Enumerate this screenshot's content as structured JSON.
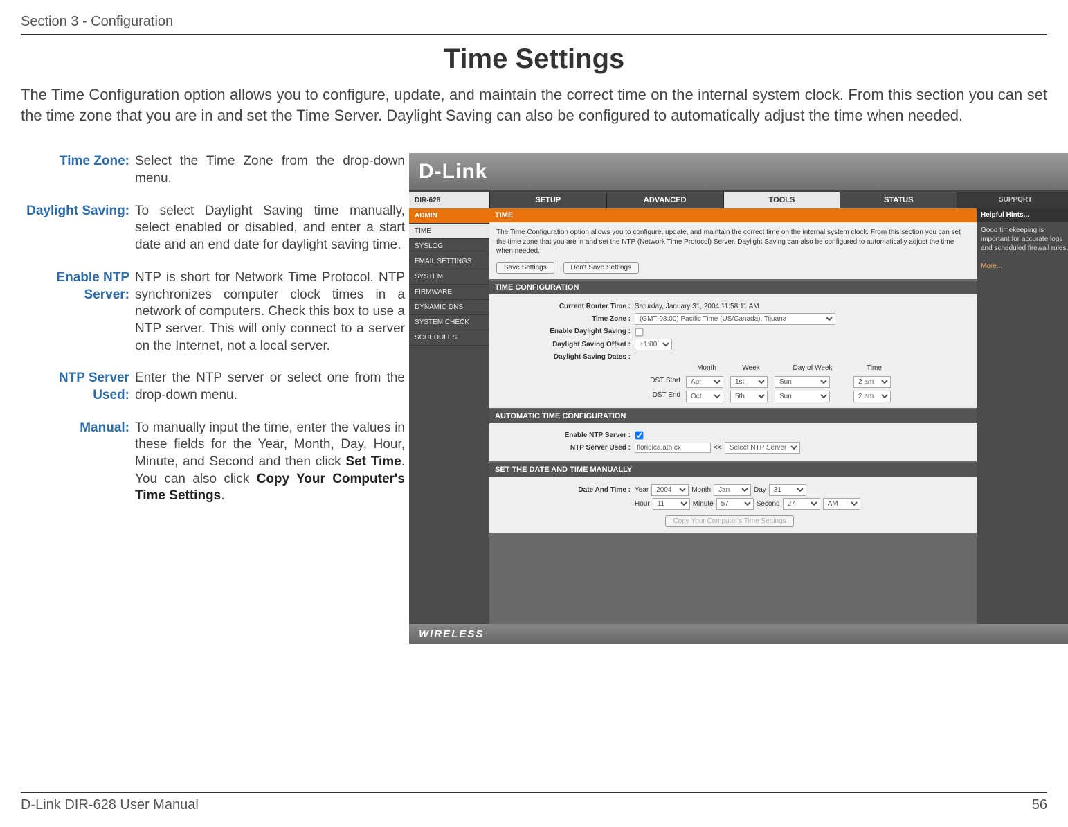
{
  "header": {
    "section": "Section 3 - Configuration"
  },
  "title": "Time Settings",
  "intro": "The Time Configuration option allows you to configure, update, and maintain the correct time on the internal system clock. From this section you can set the time zone that you are in and set the Time Server. Daylight Saving can also be configured to automatically adjust the time when needed.",
  "defs": [
    {
      "term": "Time Zone:",
      "desc": "Select the Time Zone from the drop-down menu."
    },
    {
      "term": "Daylight Saving:",
      "desc": "To select Daylight Saving time manually, select enabled or disabled, and enter a start date and an end date for daylight saving time."
    },
    {
      "term": "Enable NTP Server:",
      "desc": "NTP is short for Network Time Protocol. NTP synchronizes computer clock times in a network of computers. Check this box to use a NTP server. This will only connect to a server on the Internet, not a local server."
    },
    {
      "term": "NTP Server Used:",
      "desc": "Enter the NTP server or select one from the drop-down menu."
    },
    {
      "term": "Manual:",
      "desc_html": "To manually input the time, enter the values in these fields for the Year, Month, Day, Hour, Minute, and Second and then click <b>Set Time</b>. You can also click <b>Copy Your Computer's Time Settings</b>."
    }
  ],
  "router": {
    "logo": "D-Link",
    "model": "DIR-628",
    "tabs": [
      "SETUP",
      "ADVANCED",
      "TOOLS",
      "STATUS",
      "SUPPORT"
    ],
    "active_tab": "TOOLS",
    "side": [
      "ADMIN",
      "TIME",
      "SYSLOG",
      "EMAIL SETTINGS",
      "SYSTEM",
      "FIRMWARE",
      "DYNAMIC DNS",
      "SYSTEM CHECK",
      "SCHEDULES"
    ],
    "side_active": "TIME",
    "time_panel": {
      "head": "TIME",
      "body": "The Time Configuration option allows you to configure, update, and maintain the correct time on the internal system clock. From this section you can set the time zone that you are in and set the NTP (Network Time Protocol) Server. Daylight Saving can also be configured to automatically adjust the time when needed.",
      "save": "Save Settings",
      "dont": "Don't Save Settings"
    },
    "conf": {
      "head": "TIME CONFIGURATION",
      "current_lbl": "Current Router Time :",
      "current_val": "Saturday, January 31, 2004 11:58:11 AM",
      "tz_lbl": "Time Zone :",
      "tz_val": "(GMT-08:00) Pacific Time (US/Canada), Tijuana",
      "dls_lbl": "Enable Daylight Saving :",
      "offset_lbl": "Daylight Saving Offset :",
      "offset_val": "+1:00",
      "dates_lbl": "Daylight Saving Dates :",
      "cols": [
        "Month",
        "Week",
        "Day of Week",
        "Time"
      ],
      "start_lbl": "DST Start",
      "start": [
        "Apr",
        "1st",
        "Sun",
        "2 am"
      ],
      "end_lbl": "DST End",
      "end": [
        "Oct",
        "5th",
        "Sun",
        "2 am"
      ]
    },
    "auto": {
      "head": "AUTOMATIC TIME CONFIGURATION",
      "enable_lbl": "Enable NTP Server :",
      "used_lbl": "NTP Server Used :",
      "used_val": "floridica.ath.cx",
      "sel_lbl": "Select NTP Server",
      "arrows": "<<"
    },
    "manual": {
      "head": "SET THE DATE AND TIME MANUALLY",
      "date_lbl": "Date And Time :",
      "year_l": "Year",
      "year_v": "2004",
      "month_l": "Month",
      "month_v": "Jan",
      "day_l": "Day",
      "day_v": "31",
      "hour_l": "Hour",
      "hour_v": "11",
      "min_l": "Minute",
      "min_v": "57",
      "sec_l": "Second",
      "sec_v": "27",
      "ampm": "AM",
      "copy": "Copy Your Computer's Time Settings"
    },
    "hints": {
      "head": "Helpful Hints...",
      "body": "Good timekeeping is important for accurate logs and scheduled firewall rules.",
      "more": "More..."
    },
    "foot": "WIRELESS"
  },
  "footer": {
    "left": "D-Link DIR-628 User Manual",
    "right": "56"
  }
}
